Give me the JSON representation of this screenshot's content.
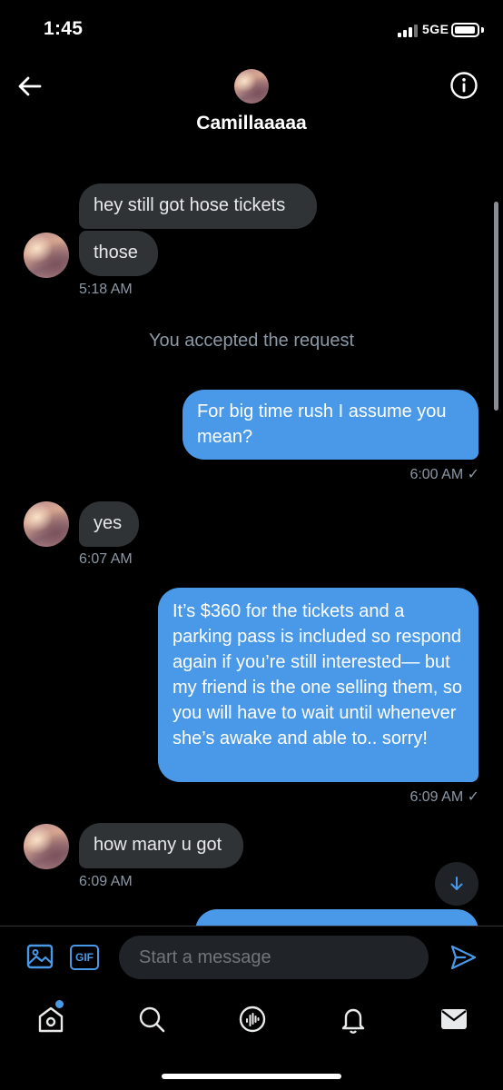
{
  "status_bar": {
    "time": "1:45",
    "network": "5GE"
  },
  "header": {
    "contact_name": "Camillaaaaa"
  },
  "conversation": {
    "incoming_1": {
      "text": "hey still got hose tickets"
    },
    "incoming_2": {
      "text": "those",
      "timestamp": "5:18 AM"
    },
    "system_note": "You accepted the request",
    "outgoing_1": {
      "text": "For big time rush I assume you mean?",
      "timestamp": "6:00 AM ✓"
    },
    "incoming_3": {
      "text": "yes",
      "timestamp": "6:07 AM"
    },
    "outgoing_2": {
      "text": "It’s $360 for the tickets and a parking pass is included so respond again if you’re still interested— but my friend is the one selling them, so you will have to wait until whenever she’s awake and able to.. sorry!",
      "timestamp": "6:09 AM ✓"
    },
    "incoming_4": {
      "text": "how many u got",
      "timestamp": "6:09 AM"
    }
  },
  "composer": {
    "placeholder": "Start a message",
    "gif_label": "GIF"
  },
  "tab_bar": {
    "items": [
      "home-icon",
      "search-icon",
      "spaces-icon",
      "notifications-icon",
      "messages-icon"
    ]
  },
  "colors": {
    "accent": "#4a99e9",
    "incoming_bubble": "#2f3336",
    "background": "#000000",
    "secondary_text": "#8b98a5"
  }
}
